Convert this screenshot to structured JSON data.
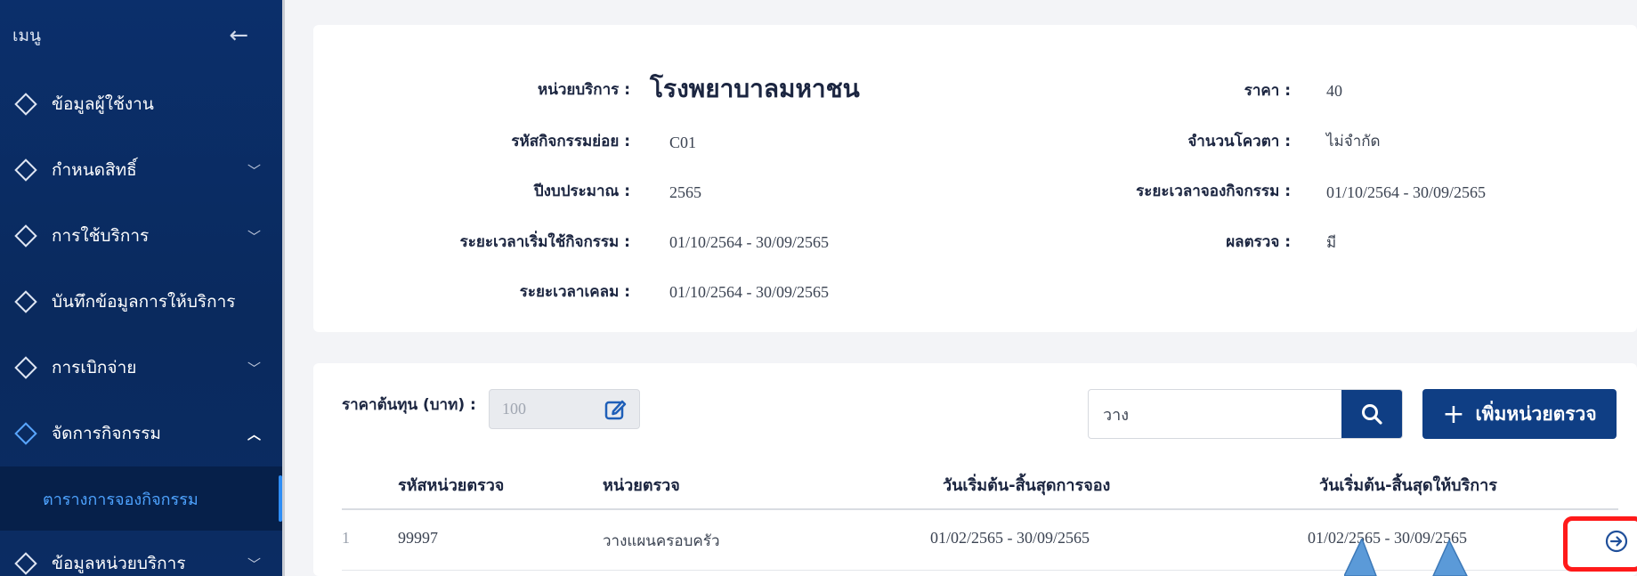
{
  "sidebar": {
    "title": "เมนู",
    "back_icon": "arrow-left-icon",
    "items": [
      {
        "label": "ข้อมูลผู้ใช้งาน",
        "has_children": false
      },
      {
        "label": "กำหนดสิทธิ์",
        "has_children": true
      },
      {
        "label": "การใช้บริการ",
        "has_children": true
      },
      {
        "label": "บันทึกข้อมูลการให้บริการ",
        "has_children": false
      },
      {
        "label": "การเบิกจ่าย",
        "has_children": true
      },
      {
        "label": "จัดการกิจกรรม",
        "has_children": true,
        "expanded": true
      },
      {
        "label": "ข้อมูลหน่วยบริการ",
        "has_children": true
      }
    ],
    "sub_item": "ตารางการจองกิจกรรม",
    "chevron_down": "⌄",
    "chevron_up": "⌃"
  },
  "info": {
    "unit_label": "หน่วยบริการ :",
    "unit_value": "โรงพยาบาลมหาชน",
    "sub_code_label": "รหัสกิจกรรมย่อย :",
    "sub_code_value": "C01",
    "budget_year_label": "ปีงบประมาณ :",
    "budget_year_value": "2565",
    "start_period_label": "ระยะเวลาเริ่มใช้กิจกรรม :",
    "start_period_value": "01/10/2564 - 30/09/2565",
    "claim_period_label": "ระยะเวลาเคลม :",
    "claim_period_value": "01/10/2564 - 30/09/2565",
    "price_label": "ราคา :",
    "price_value": "40",
    "quota_label": "จำนวนโควตา :",
    "quota_value": "ไม่จำกัด",
    "booking_period_label": "ระยะเวลาจองกิจกรรม :",
    "booking_period_value": "01/10/2564 - 30/09/2565",
    "result_label": "ผลตรวจ :",
    "result_value": "มี"
  },
  "list": {
    "cost_label": "ราคาต้นทุน (บาท) :",
    "cost_value": "100",
    "search_value": "วาง",
    "add_button": "เพิ่มหน่วยตรวจ",
    "columns": [
      "รหัสหน่วยตรวจ",
      "หน่วยตรวจ",
      "วันเริ่มต้น-สิ้นสุดการจอง",
      "วันเริ่มต้น-สิ้นสุดให้บริการ"
    ],
    "rows": [
      {
        "index": "1",
        "code": "99997",
        "name": "วางแผนครอบครัว",
        "booking": "01/02/2565 - 30/09/2565",
        "service": "01/02/2565 - 30/09/2565"
      }
    ]
  },
  "colors": {
    "sidebar_bg": "#0b2f6b",
    "accent": "#0f3e84",
    "active_link": "#4ea3ff",
    "highlight_box": "#ff1a1a",
    "pointer": "#5b9ad8"
  }
}
